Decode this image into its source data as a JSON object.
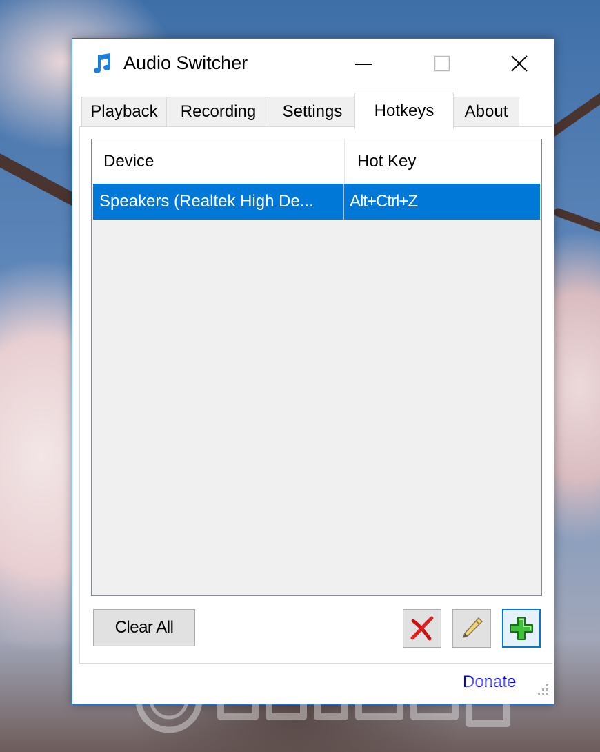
{
  "window": {
    "title": "Audio Switcher",
    "minimize_glyph": "—",
    "maximize_glyph": "☐",
    "close_glyph": "✕"
  },
  "tabs": [
    {
      "label": "Playback",
      "active": false
    },
    {
      "label": "Recording",
      "active": false
    },
    {
      "label": "Settings",
      "active": false
    },
    {
      "label": "Hotkeys",
      "active": true
    },
    {
      "label": "About",
      "active": false
    }
  ],
  "hotkeys_table": {
    "columns": [
      "Device",
      "Hot Key"
    ],
    "rows": [
      {
        "device": "Speakers (Realtek High De...",
        "hotkey": "Alt+Ctrl+Z",
        "selected": true
      }
    ]
  },
  "buttons": {
    "clear_all": "Clear All",
    "delete_icon": "red-x-icon",
    "edit_icon": "pencil-icon",
    "add_icon": "green-plus-icon"
  },
  "footer": {
    "donate": "Donate"
  },
  "colors": {
    "selection": "#0078d7",
    "link": "#0000ff",
    "window_border": "#1c6fd0"
  }
}
